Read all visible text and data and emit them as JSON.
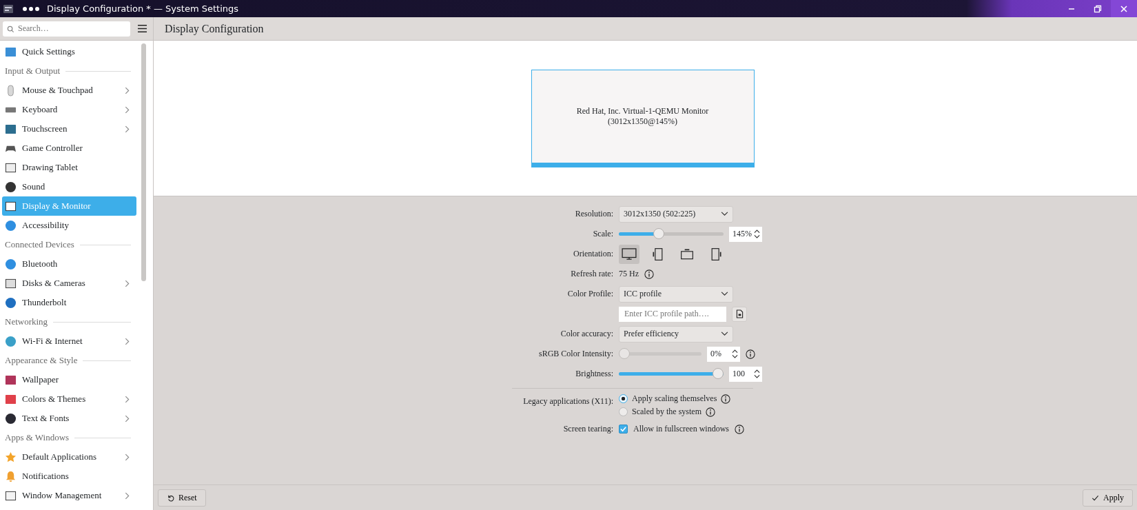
{
  "window": {
    "title": "Display Configuration * — System Settings"
  },
  "sidebar": {
    "search": {
      "placeholder": "Search…"
    },
    "sections": [
      {
        "items": [
          {
            "label": "Quick Settings",
            "arrow": false,
            "selected": false
          }
        ]
      },
      {
        "heading": "Input & Output",
        "items": [
          {
            "label": "Mouse & Touchpad",
            "arrow": true,
            "selected": false
          },
          {
            "label": "Keyboard",
            "arrow": true,
            "selected": false
          },
          {
            "label": "Touchscreen",
            "arrow": true,
            "selected": false
          },
          {
            "label": "Game Controller",
            "arrow": false,
            "selected": false
          },
          {
            "label": "Drawing Tablet",
            "arrow": false,
            "selected": false
          },
          {
            "label": "Sound",
            "arrow": false,
            "selected": false
          },
          {
            "label": "Display & Monitor",
            "arrow": false,
            "selected": true
          },
          {
            "label": "Accessibility",
            "arrow": false,
            "selected": false
          }
        ]
      },
      {
        "heading": "Connected Devices",
        "items": [
          {
            "label": "Bluetooth",
            "arrow": false,
            "selected": false
          },
          {
            "label": "Disks & Cameras",
            "arrow": true,
            "selected": false
          },
          {
            "label": "Thunderbolt",
            "arrow": false,
            "selected": false
          }
        ]
      },
      {
        "heading": "Networking",
        "items": [
          {
            "label": "Wi-Fi & Internet",
            "arrow": true,
            "selected": false
          }
        ]
      },
      {
        "heading": "Appearance & Style",
        "items": [
          {
            "label": "Wallpaper",
            "arrow": false,
            "selected": false
          },
          {
            "label": "Colors & Themes",
            "arrow": true,
            "selected": false
          },
          {
            "label": "Text & Fonts",
            "arrow": true,
            "selected": false
          }
        ]
      },
      {
        "heading": "Apps & Windows",
        "items": [
          {
            "label": "Default Applications",
            "arrow": true,
            "selected": false
          },
          {
            "label": "Notifications",
            "arrow": false,
            "selected": false
          },
          {
            "label": "Window Management",
            "arrow": true,
            "selected": false
          }
        ]
      }
    ]
  },
  "page": {
    "title": "Display Configuration"
  },
  "monitor": {
    "name": "Red Hat, Inc. Virtual-1-QEMU Monitor",
    "mode": "(3012x1350@145%)",
    "selected": true
  },
  "form": {
    "rows": [
      {
        "kind": "select",
        "label": "Resolution:",
        "value": "3012x1350 (502:225)"
      },
      {
        "kind": "slider",
        "label": "Scale:",
        "level": 0.37,
        "value": "145%",
        "info": false,
        "disabled": false
      },
      {
        "kind": "orientation",
        "label": "Orientation:",
        "options": [
          {
            "selected": true
          },
          {
            "selected": false
          },
          {
            "selected": false
          },
          {
            "selected": false
          }
        ]
      },
      {
        "kind": "text",
        "label": "Refresh rate:",
        "value": "75 Hz",
        "info": true
      },
      {
        "kind": "select",
        "label": "Color Profile:",
        "value": "ICC profile"
      },
      {
        "kind": "file",
        "placeholder": "Enter ICC profile path…."
      },
      {
        "kind": "select",
        "label": "Color accuracy:",
        "value": "Prefer efficiency"
      },
      {
        "kind": "slider",
        "label": "sRGB Color Intensity:",
        "level": 0,
        "value": "0%",
        "info": true,
        "disabled": true
      },
      {
        "kind": "slider",
        "label": "Brightness:",
        "level": 1,
        "value": "100",
        "info": false,
        "disabled": false
      },
      {
        "kind": "divider"
      },
      {
        "kind": "radio",
        "label": "Legacy applications (X11):",
        "options": [
          {
            "label": "Apply scaling themselves",
            "selected": true,
            "info": true
          },
          {
            "label": "Scaled by the system",
            "selected": false,
            "info": true
          }
        ]
      },
      {
        "kind": "checkbox",
        "label": "Screen tearing:",
        "text": "Allow in fullscreen windows",
        "checked": true,
        "info": true
      }
    ]
  },
  "footer": {
    "reset": "Reset",
    "apply": "Apply"
  }
}
